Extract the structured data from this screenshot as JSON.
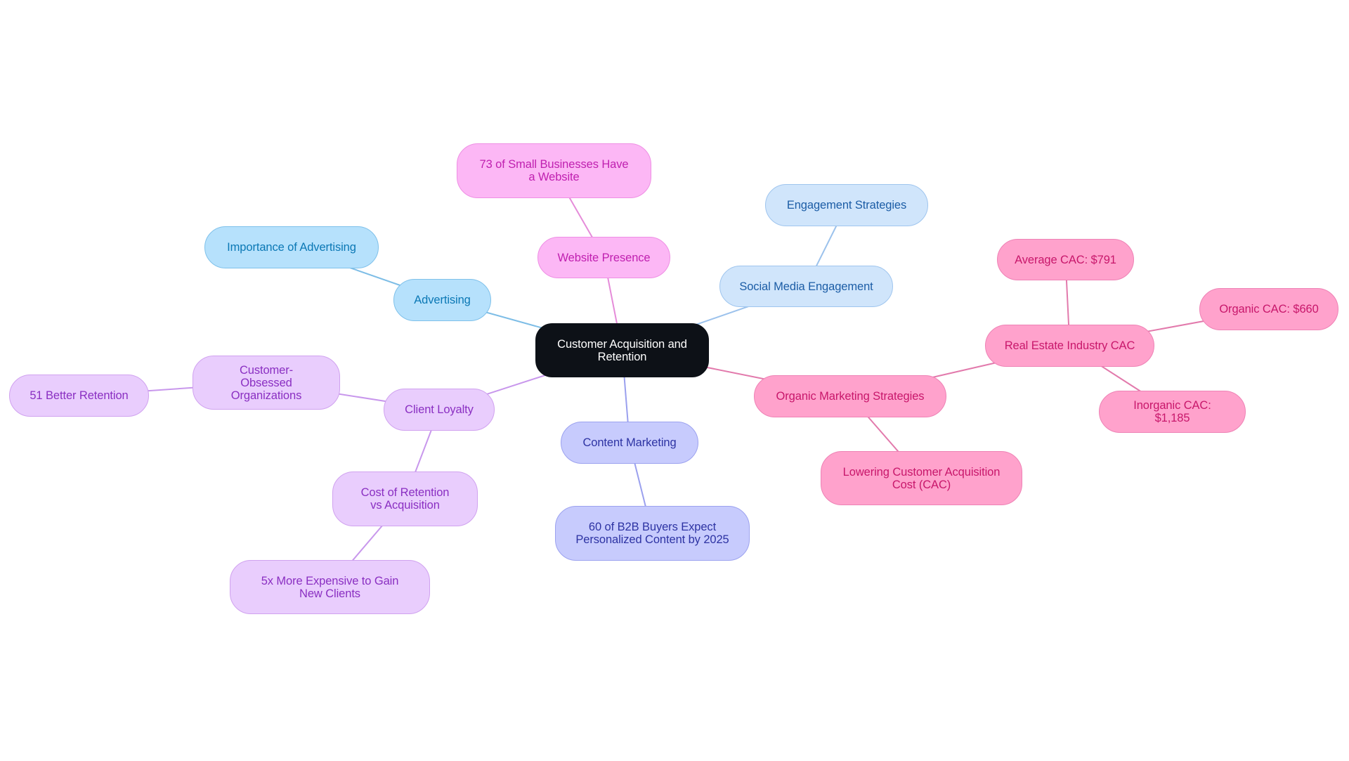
{
  "diagram": {
    "type": "mindmap",
    "root": "Customer Acquisition and Retention",
    "colors": {
      "root": "#0d1117",
      "advertising": "#b6e1fc",
      "social": "#d0e5fb",
      "website": "#fcb7f5",
      "content": "#c7cbfd",
      "loyalty": "#e9cdfd",
      "organic": "#ffa2cc"
    },
    "nodes": {
      "root": "Customer Acquisition and Retention",
      "website_presence": "Website Presence",
      "small_business_website": "73 of Small Businesses Have a Website",
      "social_media": "Social Media Engagement",
      "engagement_strategies": "Engagement Strategies",
      "advertising": "Advertising",
      "importance_advertising": "Importance of Advertising",
      "client_loyalty": "Client Loyalty",
      "customer_obsessed": "Customer-Obsessed Organizations",
      "better_retention": "51 Better Retention",
      "cost_retention": "Cost of Retention vs Acquisition",
      "more_expensive": "5x More Expensive to Gain New Clients",
      "content_marketing": "Content Marketing",
      "b2b_buyers": "60 of B2B Buyers Expect Personalized Content by 2025",
      "organic_marketing": "Organic Marketing Strategies",
      "lowering_cac": "Lowering Customer Acquisition Cost (CAC)",
      "real_estate_cac": "Real Estate Industry CAC",
      "average_cac": "Average CAC: $791",
      "organic_cac": "Organic CAC: $660",
      "inorganic_cac": "Inorganic CAC: $1,185"
    },
    "edges": [
      [
        "root",
        "website_presence"
      ],
      [
        "website_presence",
        "small_business_website"
      ],
      [
        "root",
        "social_media"
      ],
      [
        "social_media",
        "engagement_strategies"
      ],
      [
        "root",
        "advertising"
      ],
      [
        "advertising",
        "importance_advertising"
      ],
      [
        "root",
        "client_loyalty"
      ],
      [
        "client_loyalty",
        "customer_obsessed"
      ],
      [
        "customer_obsessed",
        "better_retention"
      ],
      [
        "client_loyalty",
        "cost_retention"
      ],
      [
        "cost_retention",
        "more_expensive"
      ],
      [
        "root",
        "content_marketing"
      ],
      [
        "content_marketing",
        "b2b_buyers"
      ],
      [
        "root",
        "organic_marketing"
      ],
      [
        "organic_marketing",
        "lowering_cac"
      ],
      [
        "organic_marketing",
        "real_estate_cac"
      ],
      [
        "real_estate_cac",
        "average_cac"
      ],
      [
        "real_estate_cac",
        "organic_cac"
      ],
      [
        "real_estate_cac",
        "inorganic_cac"
      ]
    ]
  }
}
